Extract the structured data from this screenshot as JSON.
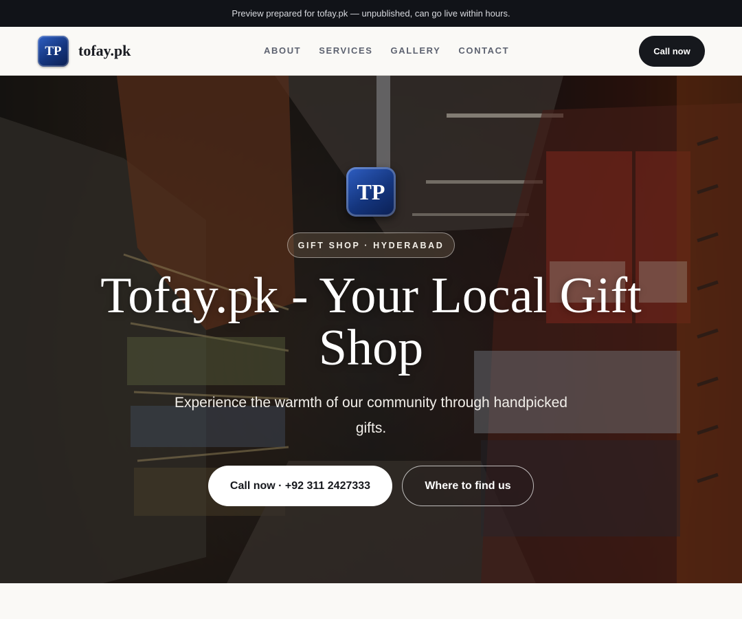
{
  "banner": {
    "text": "Preview prepared for tofay.pk — unpublished, can go live within hours."
  },
  "nav": {
    "logo_initials": "TP",
    "brand": "tofay.pk",
    "links": [
      "ABOUT",
      "SERVICES",
      "GALLERY",
      "CONTACT"
    ],
    "cta_label": "Call now"
  },
  "hero": {
    "logo_initials": "TP",
    "eyebrow": "GIFT SHOP · HYDERABAD",
    "title": "Tofay.pk - Your Local Gift Shop",
    "subtitle": "Experience the warmth of our community through handpicked gifts.",
    "primary_cta": "Call now · +92 311 2427333",
    "secondary_cta": "Where to find us",
    "background_image": "supermarket-aisle-photo"
  },
  "colors": {
    "banner_bg": "#111318",
    "nav_bg": "#faf9f6",
    "cta_dark": "#16181d",
    "logo_blue": "#14357d"
  }
}
